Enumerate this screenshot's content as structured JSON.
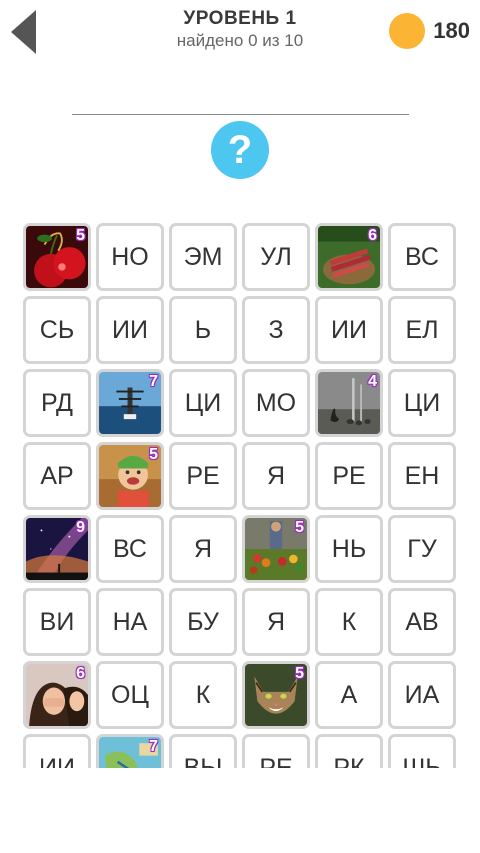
{
  "header": {
    "title": "УРОВЕНЬ 1",
    "subtitle": "найдено 0 из 10",
    "coins": "180"
  },
  "hint": {
    "symbol": "?"
  },
  "colors": {
    "coin": "#fcb434",
    "hint": "#4dc6f0",
    "back": "#555555",
    "badge_outline": "#9b2cc0"
  },
  "grid": {
    "rows": [
      [
        {
          "type": "image",
          "icon": "cherry-icon",
          "badge": "5"
        },
        {
          "type": "text",
          "text": "НО"
        },
        {
          "type": "text",
          "text": "ЭМ"
        },
        {
          "type": "text",
          "text": "УЛ"
        },
        {
          "type": "image",
          "icon": "rhubarb-basket-icon",
          "badge": "6"
        },
        {
          "type": "text",
          "text": "ВС"
        }
      ],
      [
        {
          "type": "text",
          "text": "СЬ"
        },
        {
          "type": "text",
          "text": "ИИ"
        },
        {
          "type": "text",
          "text": "Ь"
        },
        {
          "type": "text",
          "text": "З"
        },
        {
          "type": "text",
          "text": "ИИ"
        },
        {
          "type": "text",
          "text": "ЕЛ"
        }
      ],
      [
        {
          "type": "text",
          "text": "РД"
        },
        {
          "type": "image",
          "icon": "sea-horizon-icon",
          "badge": "7"
        },
        {
          "type": "text",
          "text": "ЦИ"
        },
        {
          "type": "text",
          "text": "МО"
        },
        {
          "type": "image",
          "icon": "geese-icon",
          "badge": "4"
        },
        {
          "type": "text",
          "text": "ЦИ"
        }
      ],
      [
        {
          "type": "text",
          "text": "АР"
        },
        {
          "type": "image",
          "icon": "child-icon",
          "badge": "5"
        },
        {
          "type": "text",
          "text": "РЕ"
        },
        {
          "type": "text",
          "text": "Я"
        },
        {
          "type": "text",
          "text": "РЕ"
        },
        {
          "type": "text",
          "text": "ЕН"
        }
      ],
      [
        {
          "type": "image",
          "icon": "night-sky-icon",
          "badge": "9"
        },
        {
          "type": "text",
          "text": "ВС"
        },
        {
          "type": "text",
          "text": "Я"
        },
        {
          "type": "image",
          "icon": "vegetables-icon",
          "badge": "5"
        },
        {
          "type": "text",
          "text": "НЬ"
        },
        {
          "type": "text",
          "text": "ГУ"
        }
      ],
      [
        {
          "type": "text",
          "text": "ВИ"
        },
        {
          "type": "text",
          "text": "НА"
        },
        {
          "type": "text",
          "text": "БУ"
        },
        {
          "type": "text",
          "text": "Я"
        },
        {
          "type": "text",
          "text": "К"
        },
        {
          "type": "text",
          "text": "АВ"
        }
      ],
      [
        {
          "type": "image",
          "icon": "laughing-women-icon",
          "badge": "6"
        },
        {
          "type": "text",
          "text": "ОЦ"
        },
        {
          "type": "text",
          "text": "К"
        },
        {
          "type": "image",
          "icon": "cat-icon",
          "badge": "5"
        },
        {
          "type": "text",
          "text": "А"
        },
        {
          "type": "text",
          "text": "ИА"
        }
      ],
      [
        {
          "type": "text",
          "text": "ИИ"
        },
        {
          "type": "image",
          "icon": "map-icon",
          "badge": "7"
        },
        {
          "type": "text",
          "text": "ВЫ"
        },
        {
          "type": "text",
          "text": "РЕ"
        },
        {
          "type": "text",
          "text": "РК"
        },
        {
          "type": "text",
          "text": "ШЬ"
        }
      ]
    ]
  }
}
